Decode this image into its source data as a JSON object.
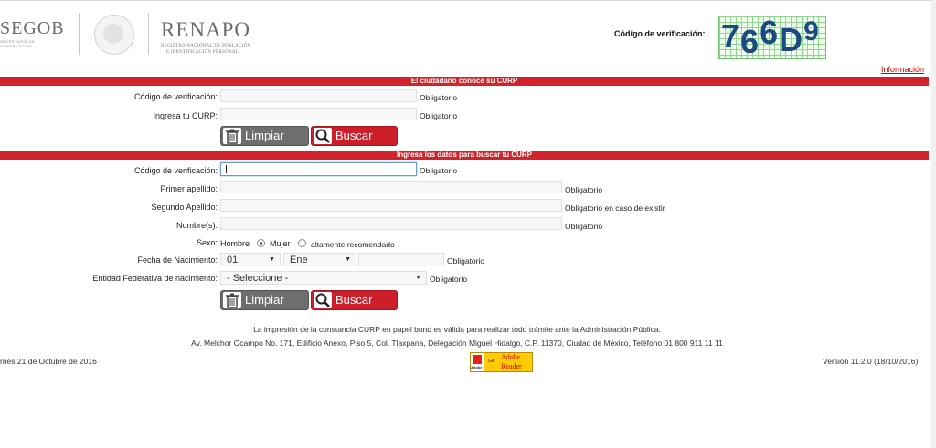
{
  "header": {
    "segob_logo": "SEGOB",
    "segob_sub1": "SECRETARÍA DE",
    "segob_sub2": "GOBERNACIÓN",
    "renapo_logo": "RENAPO",
    "renapo_sub1": "REGISTRO NACIONAL DE POBLACIÓN",
    "renapo_sub2": "E IDENTIFICACIÓN PERSONAL",
    "captcha_label": "Código de verificación:",
    "captcha_chars": [
      "7",
      "6",
      "6",
      "D",
      "9"
    ],
    "info_link": "Información"
  },
  "section1": {
    "title": "El ciudadano conoce su CURP",
    "captcha_label": "Código de verificación:",
    "captcha_value": "",
    "curp_label": "Ingresa tu CURP:",
    "curp_value": "",
    "required": "Obligatorio",
    "clear_button": "Limpiar",
    "search_button": "Buscar"
  },
  "section2": {
    "title": "Ingresa los datos para buscar tu CURP",
    "captcha_label": "Código de verificación:",
    "first_surname_label": "Primer apellido:",
    "second_surname_label": "Segundo Apellido:",
    "names_label": "Nombre(s):",
    "sex_label": "Sexo:",
    "sex_male": "Hombre",
    "sex_female": "Mujer",
    "sex_note": "altamente recomendado",
    "birthdate_label": "Fecha de Nacimiento:",
    "day_value": "01",
    "month_value": "Ene",
    "year_value": "",
    "state_label": "Entidad Federativa de nacimiento:",
    "state_value": "- Seleccione -",
    "required": "Obligatorio",
    "required_if_exists": "Obligatorio en caso de existir",
    "clear_button": "Limpiar",
    "search_button": "Buscar"
  },
  "footer": {
    "notice": "La impresión de la constancia CURP en papel bond es válida para realizar todo trámite ante la Administración Pública.",
    "address": "Av. Melchor Ocampo No. 171, Edificio Anexo, Piso 5, Col. Tlaxpana, Delegación Miguel Hidalgo, C.P. 11370, Ciudad de México, Teléfono 01 800 911 11 11",
    "date": "rnes 21 de Octubre de 2016",
    "adobe_small": "Get",
    "adobe_big1": "Adobe",
    "adobe_big2": "Reader",
    "adobe_brand": "Adobe",
    "version": "Versión 11.2.0 (18/10/2016)"
  },
  "colors": {
    "band_red": "#d2232a",
    "button_red": "#cc1f2b",
    "button_gray": "#6e6e6e",
    "captcha_text": "#1b4a82",
    "link_red": "#cc0000"
  }
}
